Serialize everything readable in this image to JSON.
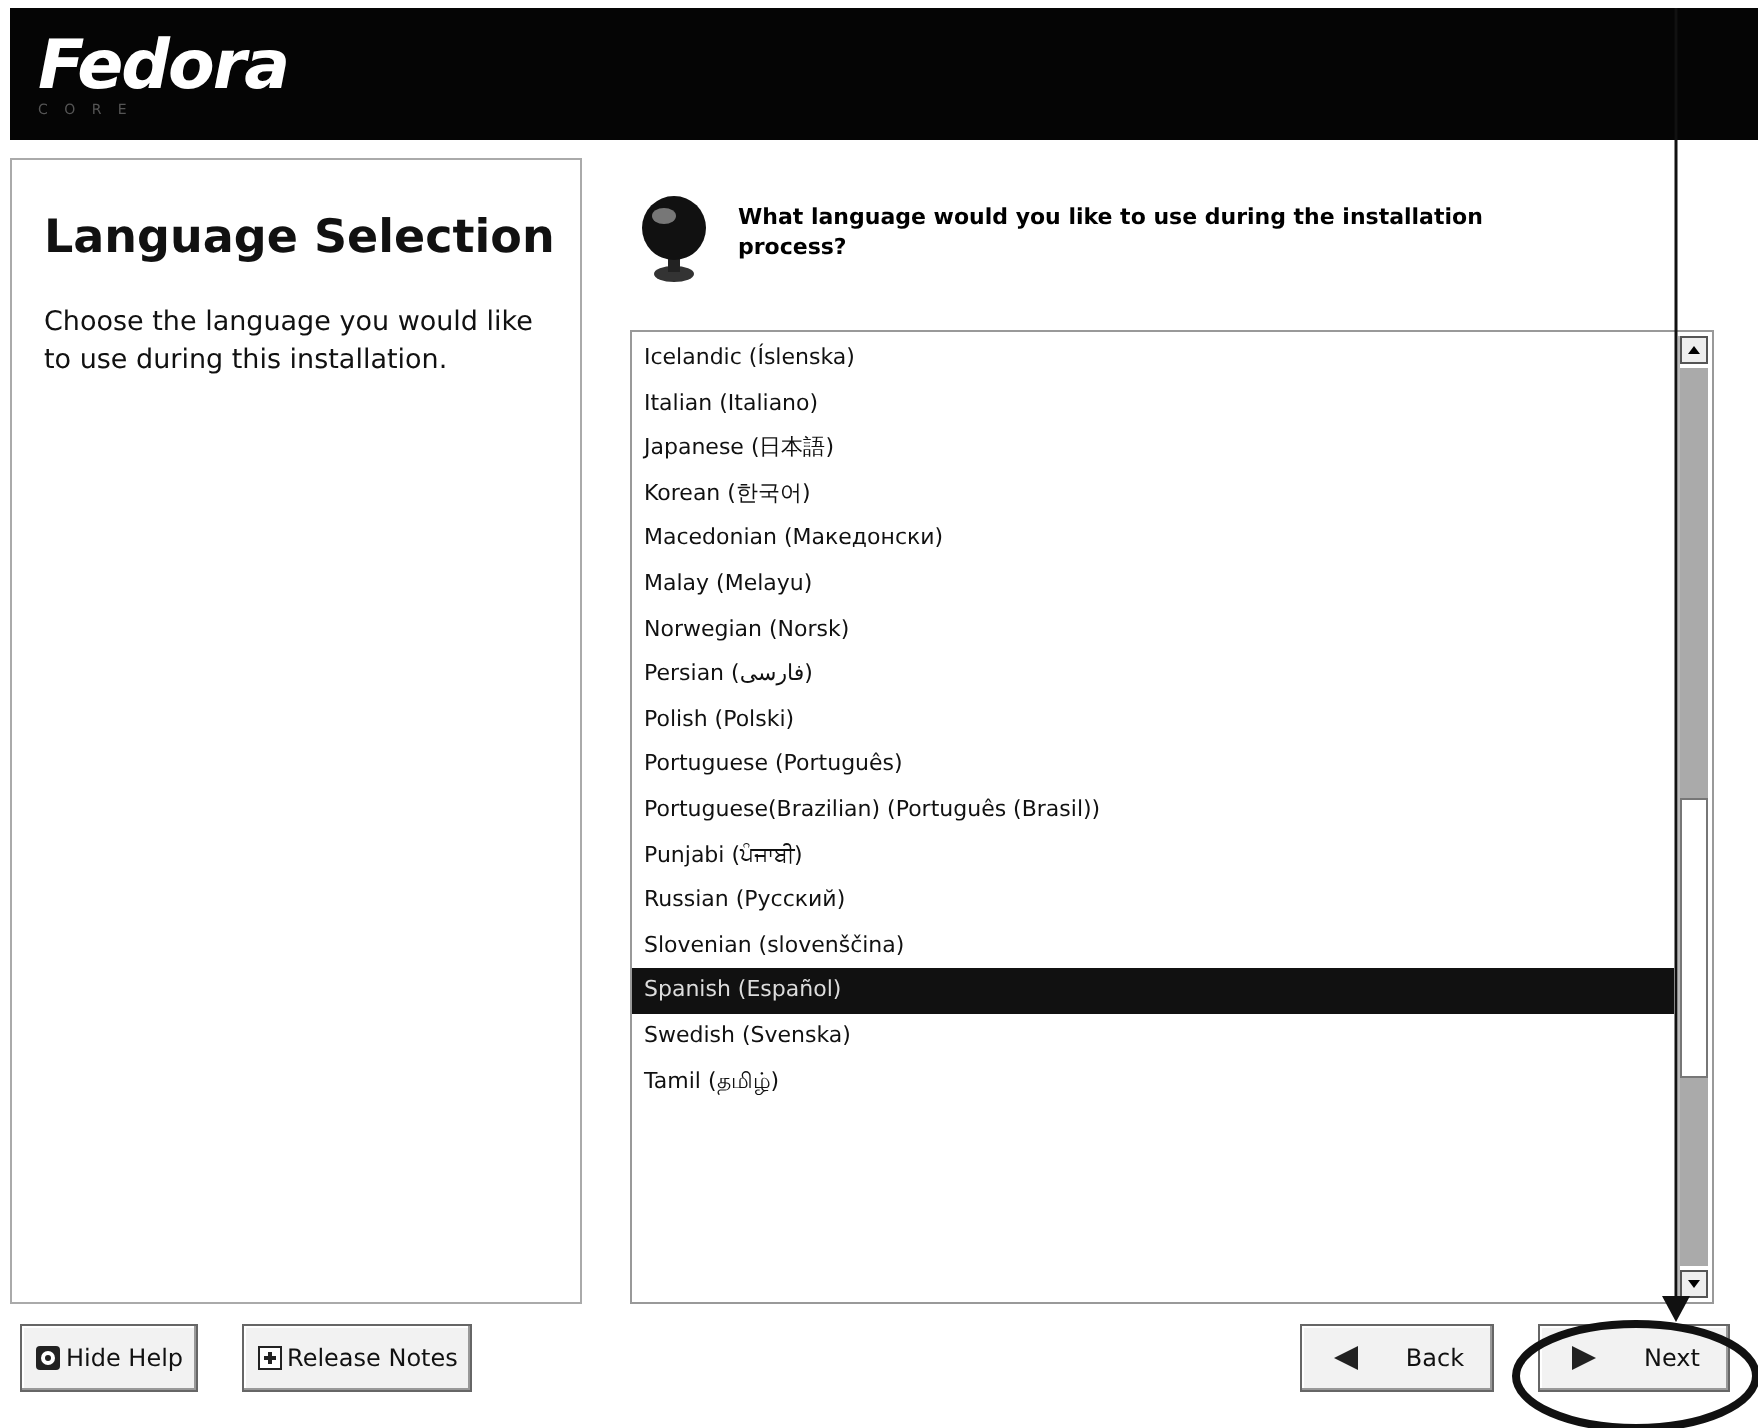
{
  "header": {
    "logo": "Fedora",
    "logo_sub": "C O R E"
  },
  "help": {
    "title": "Language Selection",
    "text": "Choose the language you would like to use during this installation."
  },
  "question": "What language would you like to use during the installation process?",
  "languages": [
    {
      "label": "Icelandic (Íslenska)",
      "selected": false
    },
    {
      "label": "Italian (Italiano)",
      "selected": false
    },
    {
      "label": "Japanese (日本語)",
      "selected": false
    },
    {
      "label": "Korean (한국어)",
      "selected": false
    },
    {
      "label": "Macedonian (Македонски)",
      "selected": false
    },
    {
      "label": "Malay (Melayu)",
      "selected": false
    },
    {
      "label": "Norwegian (Norsk)",
      "selected": false
    },
    {
      "label": "Persian (فارسی)",
      "selected": false
    },
    {
      "label": "Polish (Polski)",
      "selected": false
    },
    {
      "label": "Portuguese (Português)",
      "selected": false
    },
    {
      "label": "Portuguese(Brazilian) (Português (Brasil))",
      "selected": false
    },
    {
      "label": "Punjabi (ਪੰਜਾਬੀ)",
      "selected": false
    },
    {
      "label": "Russian (Русский)",
      "selected": false
    },
    {
      "label": "Slovenian (slovenščina)",
      "selected": false
    },
    {
      "label": "Spanish (Español)",
      "selected": true
    },
    {
      "label": "Swedish (Svenska)",
      "selected": false
    },
    {
      "label": "Tamil (தமிழ்)",
      "selected": false
    }
  ],
  "buttons": [
    {
      "label": "Hide Help",
      "kind": "help"
    },
    {
      "label": "Release Notes",
      "kind": "notes"
    },
    {
      "label": "Back",
      "kind": "back"
    },
    {
      "label": "Next",
      "kind": "next"
    }
  ]
}
